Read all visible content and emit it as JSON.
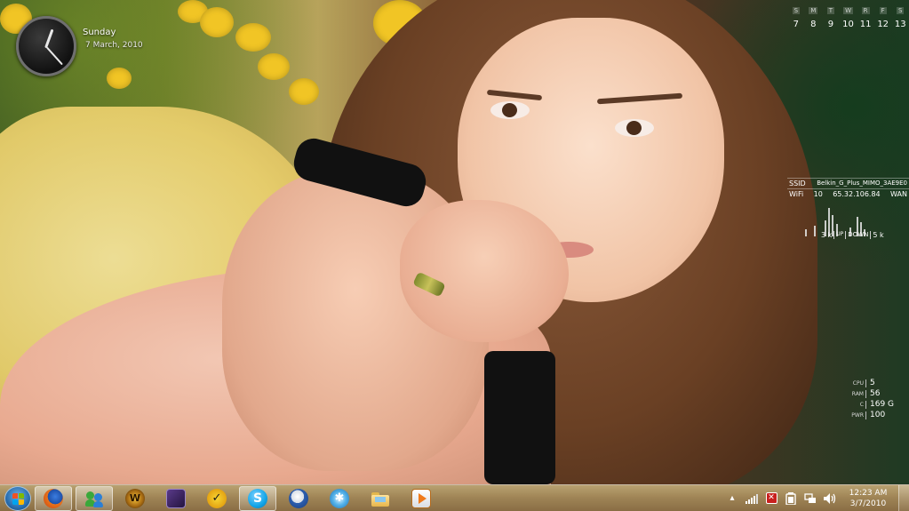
{
  "desktop": {
    "clock_gadget": {
      "day": "Sunday",
      "date": "7 March, 2010"
    },
    "calendar": {
      "weekdays": [
        "S",
        "M",
        "T",
        "W",
        "R",
        "F",
        "S"
      ],
      "days": [
        "7",
        "8",
        "9",
        "10",
        "11",
        "12",
        "13"
      ]
    },
    "network": {
      "ssid_label": "SSID",
      "ssid_value": "Belkin_G_Plus_MIMO_3AE9E0",
      "wifi_label": "WiFi",
      "wifi_value": "10",
      "ip": "65.32.106.84",
      "wan_label": "WAN",
      "up_value": "3 k",
      "up_label": "UP",
      "down_label": "DOWN",
      "down_value": "5 k"
    },
    "system": [
      {
        "label": "CPU",
        "value": "5"
      },
      {
        "label": "RAM",
        "value": "56"
      },
      {
        "label": "C",
        "value": "169 G"
      },
      {
        "label": "PWR",
        "value": "100"
      }
    ]
  },
  "taskbar": {
    "pinned": [
      {
        "name": "firefox",
        "icon": "firefox-icon",
        "active": true
      },
      {
        "name": "messenger",
        "icon": "messenger-icon",
        "active": true
      },
      {
        "name": "world-of-warcraft",
        "icon": "wow-icon",
        "active": false
      },
      {
        "name": "media-app",
        "icon": "media-app-icon",
        "active": false
      },
      {
        "name": "norton",
        "icon": "norton-icon",
        "active": false
      },
      {
        "name": "skype",
        "icon": "skype-icon",
        "active": true
      },
      {
        "name": "sonic",
        "icon": "sonic-icon",
        "active": false
      },
      {
        "name": "app-blue-star",
        "icon": "star-app-icon",
        "active": false
      },
      {
        "name": "windows-explorer",
        "icon": "folder-icon",
        "active": false
      },
      {
        "name": "media-player",
        "icon": "media-player-icon",
        "active": false
      }
    ],
    "tray": {
      "time": "12:23 AM",
      "date": "3/7/2010"
    }
  },
  "colors": {
    "taskbar": "#a98b5c",
    "start_orb": "#2a6fb0",
    "active_button_highlight": "#ffffff"
  }
}
